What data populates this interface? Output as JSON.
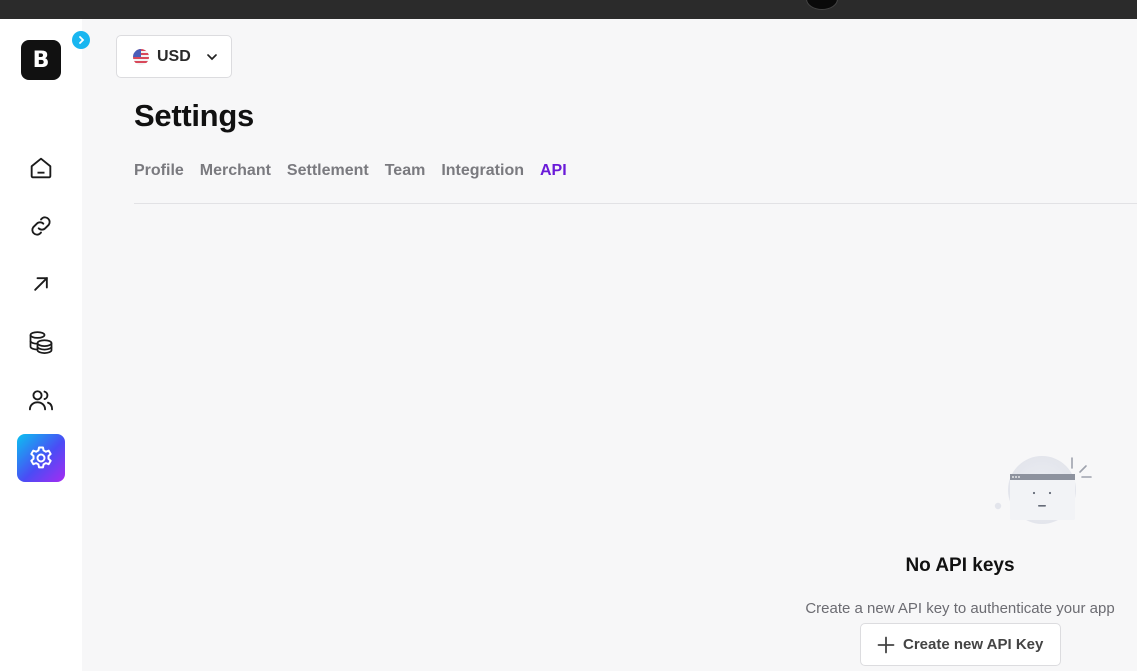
{
  "topbar": {
    "avatar_icon": "user-avatar"
  },
  "brand": {
    "logo_text": "B"
  },
  "sidebar": {
    "items": [
      {
        "name": "home",
        "icon": "home-icon"
      },
      {
        "name": "links",
        "icon": "link-icon"
      },
      {
        "name": "send",
        "icon": "arrow-up-right-icon"
      },
      {
        "name": "coins",
        "icon": "coins-icon"
      },
      {
        "name": "users",
        "icon": "users-icon"
      },
      {
        "name": "settings",
        "icon": "gear-icon",
        "active": true
      }
    ]
  },
  "currency": {
    "value": "USD",
    "flag": "us-flag-icon"
  },
  "page": {
    "title": "Settings"
  },
  "tabs": [
    {
      "label": "Profile"
    },
    {
      "label": "Merchant"
    },
    {
      "label": "Settlement"
    },
    {
      "label": "Team"
    },
    {
      "label": "Integration"
    },
    {
      "label": "API",
      "active": true
    }
  ],
  "empty_state": {
    "title": "No API keys",
    "description": "Create a new API key to authenticate your app",
    "button_label": "Create new API Key"
  },
  "colors": {
    "accent": "#6a1ad8",
    "expand_button": "#19b6f0",
    "active_nav_gradient": [
      "#0bc2f0",
      "#4a4cf5",
      "#a62bf2"
    ]
  }
}
